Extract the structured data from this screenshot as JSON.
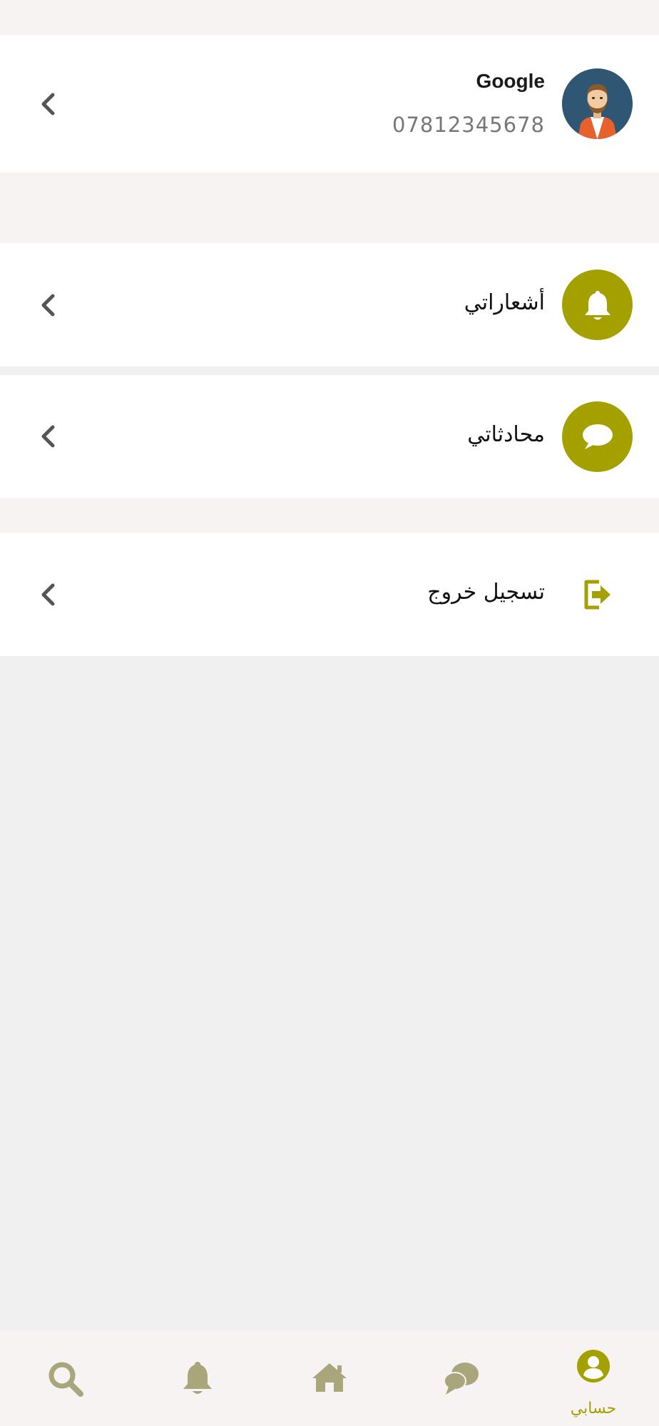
{
  "profile": {
    "name": "Google",
    "phone": "07812345678"
  },
  "menu": {
    "notifications_label": "أشعاراتي",
    "chats_label": "محادثاتي",
    "logout_label": "تسجيل خروج"
  },
  "bottom_nav": {
    "items": [
      {
        "icon": "search-icon",
        "label": ""
      },
      {
        "icon": "bell-icon",
        "label": ""
      },
      {
        "icon": "home-icon",
        "label": ""
      },
      {
        "icon": "chat-icon",
        "label": ""
      },
      {
        "icon": "account-icon",
        "label": "حسابي",
        "active": true
      }
    ]
  },
  "colors": {
    "accent": "#a3a000",
    "nav_inactive": "#a8a67a",
    "avatar_bg": "#2f5773",
    "page_bg": "#f0f0f0",
    "section_bg": "#f6f3f2"
  }
}
